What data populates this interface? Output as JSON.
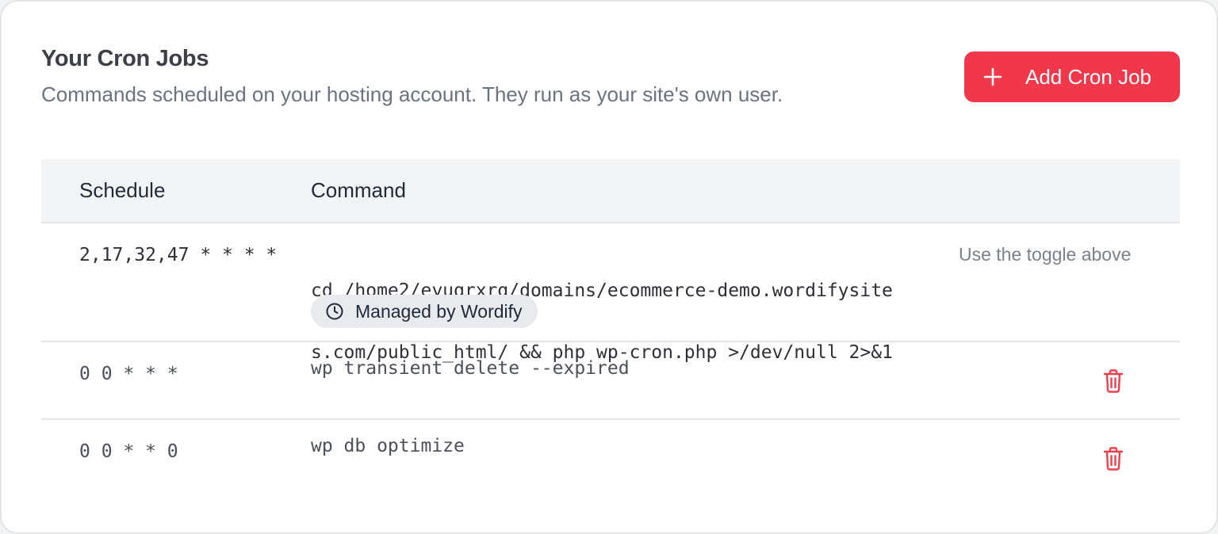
{
  "header": {
    "title": "Your Cron Jobs",
    "subtitle": "Commands scheduled on your hosting account. They run as your site's own user.",
    "add_button_label": "Add Cron Job"
  },
  "table": {
    "columns": [
      "Schedule",
      "Command"
    ],
    "rows": [
      {
        "schedule": "2,17,32,47 * * * *",
        "command_line1": "cd /home2/eyuqrxrg/domains/ecommerce-demo.wordifysite",
        "command_line2": "s.com/public_html/ && php wp-cron.php >/dev/null 2>&1",
        "badge": "Managed by Wordify",
        "action_hint": "Use the toggle above"
      },
      {
        "schedule": "0 0 * * *",
        "command": "wp transient delete --expired"
      },
      {
        "schedule": "0 0 * * 0",
        "command": "wp db optimize"
      }
    ]
  },
  "icons": {
    "add": "plus-icon",
    "badge": "clock-icon",
    "delete": "trash-icon"
  },
  "colors": {
    "accent": "#f1384b",
    "trash": "#ef3e4e",
    "header_bg": "#f3f4f6"
  }
}
